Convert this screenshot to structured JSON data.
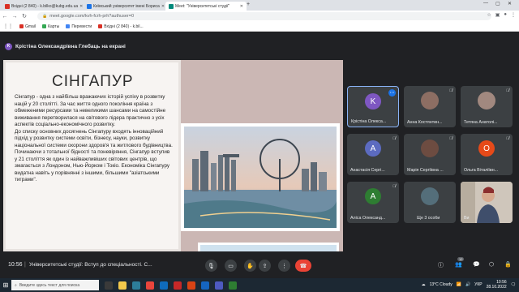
{
  "browser": {
    "tabs": [
      {
        "label": "Вхідні (2 840) - k.bilko@kubg.edu.ua"
      },
      {
        "label": "Київський університет імені Бориса"
      },
      {
        "label": "Meet: \"Університетські студії\""
      }
    ],
    "url": "meet.google.com/kvh-fcrh-prh?authuser=0",
    "bookmarks": [
      {
        "label": "Gmail"
      },
      {
        "label": "Карты"
      },
      {
        "label": "Перевести"
      },
      {
        "label": "Вхідні (2 840) - k.bil..."
      }
    ]
  },
  "meet": {
    "presenter_initial": "K",
    "presenter_label": "Крістіна Олександрівна Глебаць на екрані",
    "slide": {
      "title": "СІНГАПУР",
      "paragraphs": [
        "Сінгапур - одна з найбільш вражаючих історій успіху в розвитку націй у 20 столітті. За час життя одного покоління країна з обмеженими ресурсами та невеликими шансами на самостійне виживання перетворилася на світового лідера практично з усіх аспектів соціально-економічного розвитку.",
        "До списку основних досягнень Сінгапуру входять інноваційний підхід у розвитку системи освіти, бізнесу, науки, розвитку національної системи охорони здоров'я та житлового будівництва.",
        "Починаючи з тотальної бідності та поневіряння, Сінгапур вступив у 21 століття як один із найважливіших світових центрів, що змагається з Лондоном, Нью-Йорком і Токіо. Економіка Сінгапуру видатна навіть у порівнянні з іншими, більшими \"азіатськими тиграми\"."
      ]
    },
    "participants": [
      {
        "initial": "K",
        "name": "Крістіна Олекса...",
        "color": "#7e57c2",
        "active": true
      },
      {
        "initial": "",
        "name": "Анна Костянтин...",
        "color": "#5d4037",
        "photo": true
      },
      {
        "initial": "",
        "name": "Тетяна Анатолі...",
        "color": "#795548",
        "photo": true
      },
      {
        "initial": "A",
        "name": "Анастасія Сергі...",
        "color": "#5c6bc0"
      },
      {
        "initial": "",
        "name": "Марія Сергіївна ...",
        "color": "#6d4c41",
        "photo": true
      },
      {
        "initial": "O",
        "name": "Ольга Віталіївн...",
        "color": "#e64a19"
      },
      {
        "initial": "A",
        "name": "Аліса Олександ...",
        "color": "#2e7d32"
      },
      {
        "initial": "",
        "name": "Ще 3 особи",
        "color": "#546e7a",
        "group": true
      },
      {
        "initial": "",
        "name": "Ви",
        "video": true
      }
    ]
  },
  "bottombar": {
    "time": "10:56",
    "meeting_name": "Університетські студії: Вступ до спеціальності. С...",
    "people_count": "12"
  },
  "taskbar": {
    "search_placeholder": "Введите здесь текст для поиска",
    "weather": "13°C  Cloudy",
    "lang": "УКР",
    "time": "10:56",
    "date": "28.10.2022"
  }
}
